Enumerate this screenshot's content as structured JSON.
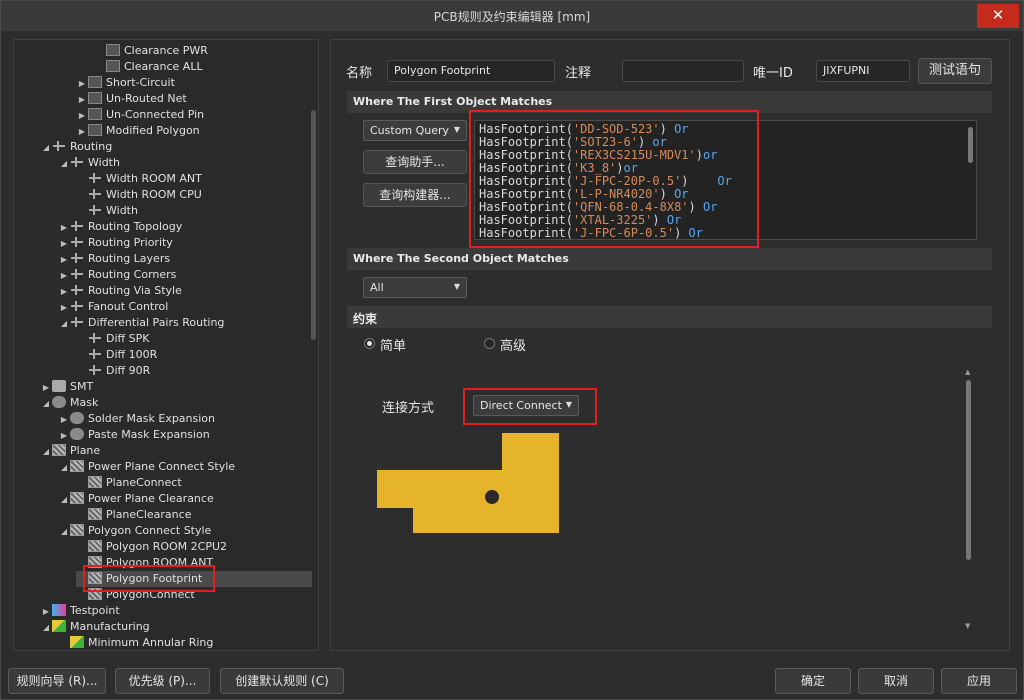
{
  "window": {
    "title": "PCB规则及约束编辑器 [mm]",
    "close_glyph": "✕"
  },
  "tree": {
    "items": [
      {
        "label": "Clearance PWR",
        "indent": 4,
        "icon": "rule",
        "arrow": ""
      },
      {
        "label": "Clearance ALL",
        "indent": 4,
        "icon": "rule",
        "arrow": ""
      },
      {
        "label": "Short-Circuit",
        "indent": 3,
        "icon": "rule",
        "arrow": "▶"
      },
      {
        "label": "Un-Routed Net",
        "indent": 3,
        "icon": "rule",
        "arrow": "▶"
      },
      {
        "label": "Un-Connected Pin",
        "indent": 3,
        "icon": "rule",
        "arrow": "▶"
      },
      {
        "label": "Modified Polygon",
        "indent": 3,
        "icon": "rule",
        "arrow": "▶"
      },
      {
        "label": "Routing",
        "indent": 1,
        "icon": "route",
        "arrow": "◢"
      },
      {
        "label": "Width",
        "indent": 2,
        "icon": "route",
        "arrow": "◢"
      },
      {
        "label": "Width ROOM ANT",
        "indent": 3,
        "icon": "route",
        "arrow": ""
      },
      {
        "label": "Width ROOM CPU",
        "indent": 3,
        "icon": "route",
        "arrow": ""
      },
      {
        "label": "Width",
        "indent": 3,
        "icon": "route",
        "arrow": ""
      },
      {
        "label": "Routing Topology",
        "indent": 2,
        "icon": "route",
        "arrow": "▶"
      },
      {
        "label": "Routing Priority",
        "indent": 2,
        "icon": "route",
        "arrow": "▶"
      },
      {
        "label": "Routing Layers",
        "indent": 2,
        "icon": "route",
        "arrow": "▶"
      },
      {
        "label": "Routing Corners",
        "indent": 2,
        "icon": "route",
        "arrow": "▶"
      },
      {
        "label": "Routing Via Style",
        "indent": 2,
        "icon": "route",
        "arrow": "▶"
      },
      {
        "label": "Fanout Control",
        "indent": 2,
        "icon": "route",
        "arrow": "▶"
      },
      {
        "label": "Differential Pairs Routing",
        "indent": 2,
        "icon": "route",
        "arrow": "◢"
      },
      {
        "label": "Diff SPK",
        "indent": 3,
        "icon": "route",
        "arrow": ""
      },
      {
        "label": "Diff 100R",
        "indent": 3,
        "icon": "route",
        "arrow": ""
      },
      {
        "label": "Diff 90R",
        "indent": 3,
        "icon": "route",
        "arrow": ""
      },
      {
        "label": "SMT",
        "indent": 1,
        "icon": "smt",
        "arrow": "▶"
      },
      {
        "label": "Mask",
        "indent": 1,
        "icon": "mask",
        "arrow": "◢"
      },
      {
        "label": "Solder Mask Expansion",
        "indent": 2,
        "icon": "mask",
        "arrow": "▶"
      },
      {
        "label": "Paste Mask Expansion",
        "indent": 2,
        "icon": "mask",
        "arrow": "▶"
      },
      {
        "label": "Plane",
        "indent": 1,
        "icon": "plane",
        "arrow": "◢"
      },
      {
        "label": "Power Plane Connect Style",
        "indent": 2,
        "icon": "plane",
        "arrow": "◢"
      },
      {
        "label": "PlaneConnect",
        "indent": 3,
        "icon": "plane",
        "arrow": ""
      },
      {
        "label": "Power Plane Clearance",
        "indent": 2,
        "icon": "plane",
        "arrow": "◢"
      },
      {
        "label": "PlaneClearance",
        "indent": 3,
        "icon": "plane",
        "arrow": ""
      },
      {
        "label": "Polygon Connect Style",
        "indent": 2,
        "icon": "plane",
        "arrow": "◢"
      },
      {
        "label": "Polygon ROOM 2CPU2",
        "indent": 3,
        "icon": "plane",
        "arrow": ""
      },
      {
        "label": "Polygon ROOM ANT",
        "indent": 3,
        "icon": "plane",
        "arrow": ""
      },
      {
        "label": "Polygon Footprint",
        "indent": 3,
        "icon": "plane",
        "arrow": "",
        "selected": true
      },
      {
        "label": "PolygonConnect",
        "indent": 3,
        "icon": "plane",
        "arrow": ""
      },
      {
        "label": "Testpoint",
        "indent": 1,
        "icon": "test",
        "arrow": "▶"
      },
      {
        "label": "Manufacturing",
        "indent": 1,
        "icon": "mfg",
        "arrow": "◢"
      },
      {
        "label": "Minimum Annular Ring",
        "indent": 2,
        "icon": "mfg",
        "arrow": ""
      }
    ]
  },
  "rule": {
    "name_label": "名称",
    "name_value": "Polygon Footprint",
    "comment_label": "注释",
    "comment_value": "",
    "uid_label": "唯一ID",
    "uid_value": "JIXFUPNI",
    "test_button": "测试语句"
  },
  "first_match": {
    "header": "Where The First Object Matches",
    "combo": "Custom Query",
    "helper_button": "查询助手...",
    "builder_button": "查询构建器...",
    "query_lines": [
      {
        "fn": "HasFootprint(",
        "str": "'DD-SOD-523'",
        "close": ") ",
        "op": "Or"
      },
      {
        "fn": "HasFootprint(",
        "str": "'SOT23-6'",
        "close": ") ",
        "op": "or"
      },
      {
        "fn": "HasFootprint(",
        "str": "'REX3CS215U-MDV1'",
        "close": ")",
        "op": "or"
      },
      {
        "fn": "HasFootprint(",
        "str": "'K3_8'",
        "close": ")",
        "op": "or"
      },
      {
        "fn": "HasFootprint(",
        "str": "'J-FPC-20P-0.5'",
        "close": ")    ",
        "op": "Or"
      },
      {
        "fn": "HasFootprint(",
        "str": "'L-P-NR4020'",
        "close": ") ",
        "op": "Or"
      },
      {
        "fn": "HasFootprint(",
        "str": "'QFN-68-0.4-8X8'",
        "close": ") ",
        "op": "Or"
      },
      {
        "fn": "HasFootprint(",
        "str": "'XTAL-3225'",
        "close": ") ",
        "op": "Or"
      },
      {
        "fn": "HasFootprint(",
        "str": "'J-FPC-6P-0.5'",
        "close": ") ",
        "op": "Or"
      }
    ]
  },
  "second_match": {
    "header": "Where The Second Object Matches",
    "combo": "All"
  },
  "constraint": {
    "header": "约束",
    "simple_label": "简单",
    "advanced_label": "高级",
    "connect_label": "连接方式",
    "connect_value": "Direct Connect",
    "pad_color": "#e6b42a"
  },
  "footer": {
    "wizard": "规则向导 (R)...",
    "priority": "优先级 (P)...",
    "create_default": "创建默认规则 (C)",
    "ok": "确定",
    "cancel": "取消",
    "apply": "应用"
  }
}
